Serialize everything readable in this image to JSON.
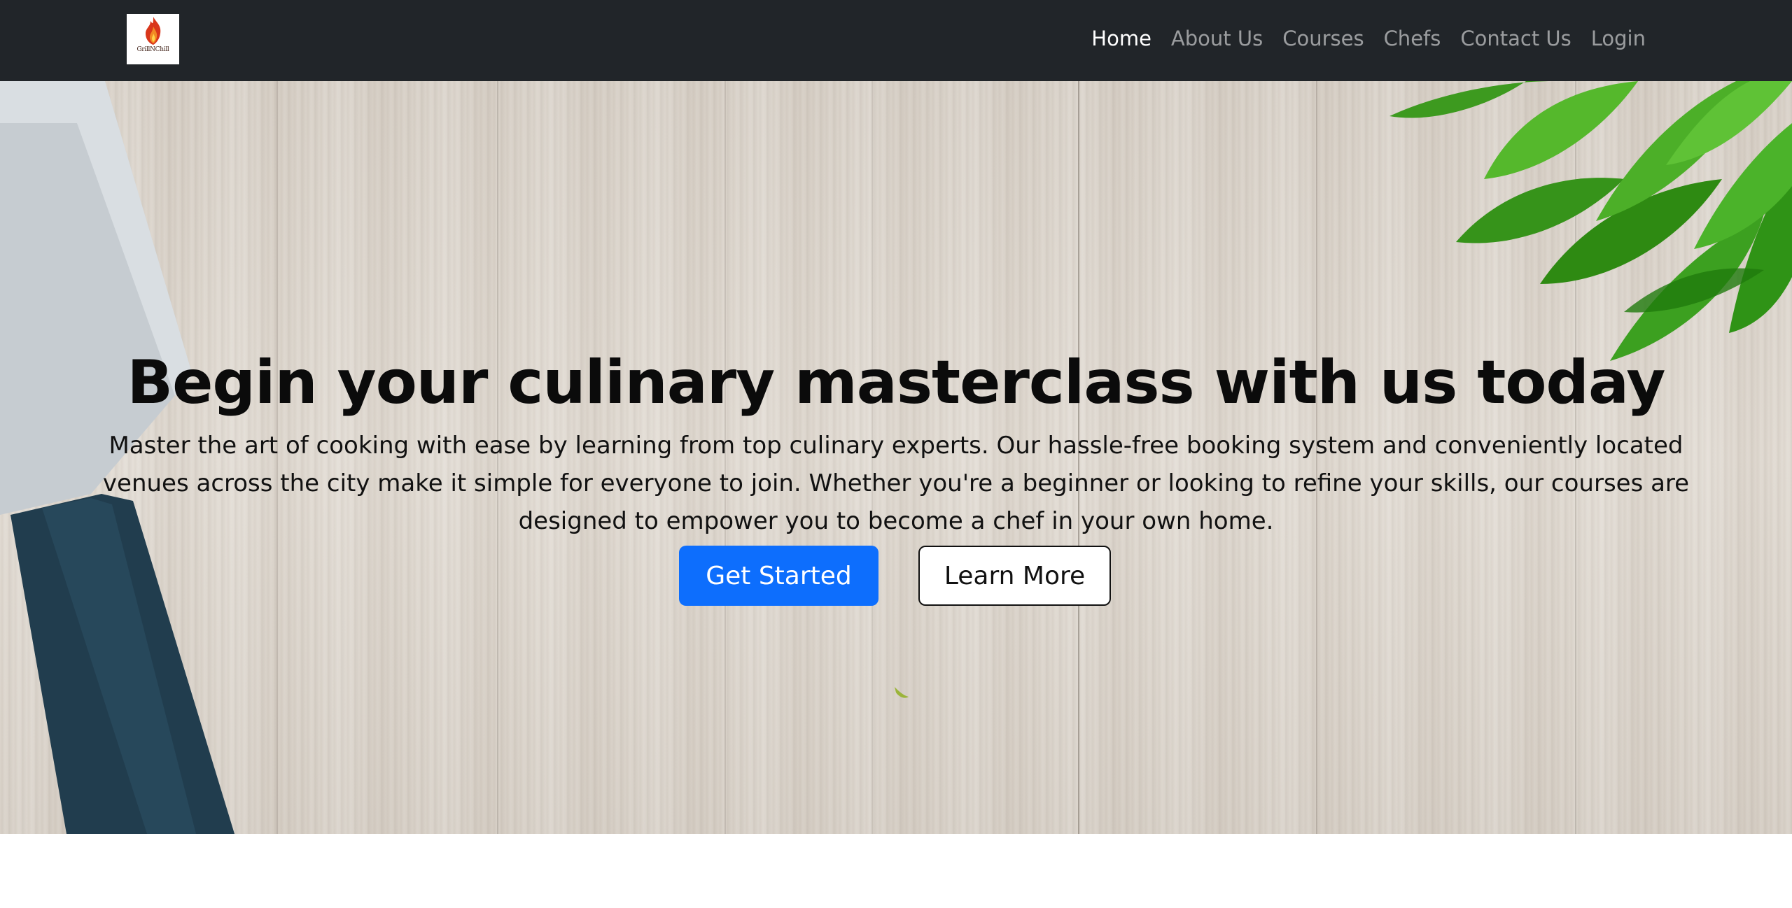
{
  "navbar": {
    "logo_text": "GrillNChill",
    "links": [
      {
        "label": "Home",
        "active": true
      },
      {
        "label": "About Us",
        "active": false
      },
      {
        "label": "Courses",
        "active": false
      },
      {
        "label": "Chefs",
        "active": false
      },
      {
        "label": "Contact Us",
        "active": false
      },
      {
        "label": "Login",
        "active": false
      }
    ]
  },
  "hero": {
    "title": "Begin your culinary masterclass with us today",
    "description": "Master the art of cooking with ease by learning from top culinary experts. Our hassle-free booking system and conveniently located venues across the city make it simple for everyone to join. Whether you're a beginner or looking to refine your skills, our courses are designed to empower you to become a chef in your own home.",
    "primary_button": "Get Started",
    "secondary_button": "Learn More"
  },
  "colors": {
    "navbar_bg": "#212529",
    "primary": "#0d6efd",
    "nav_active": "#ffffff",
    "nav_inactive": "#9a9b9d"
  },
  "icons": {
    "logo": "flame-logo-icon"
  }
}
